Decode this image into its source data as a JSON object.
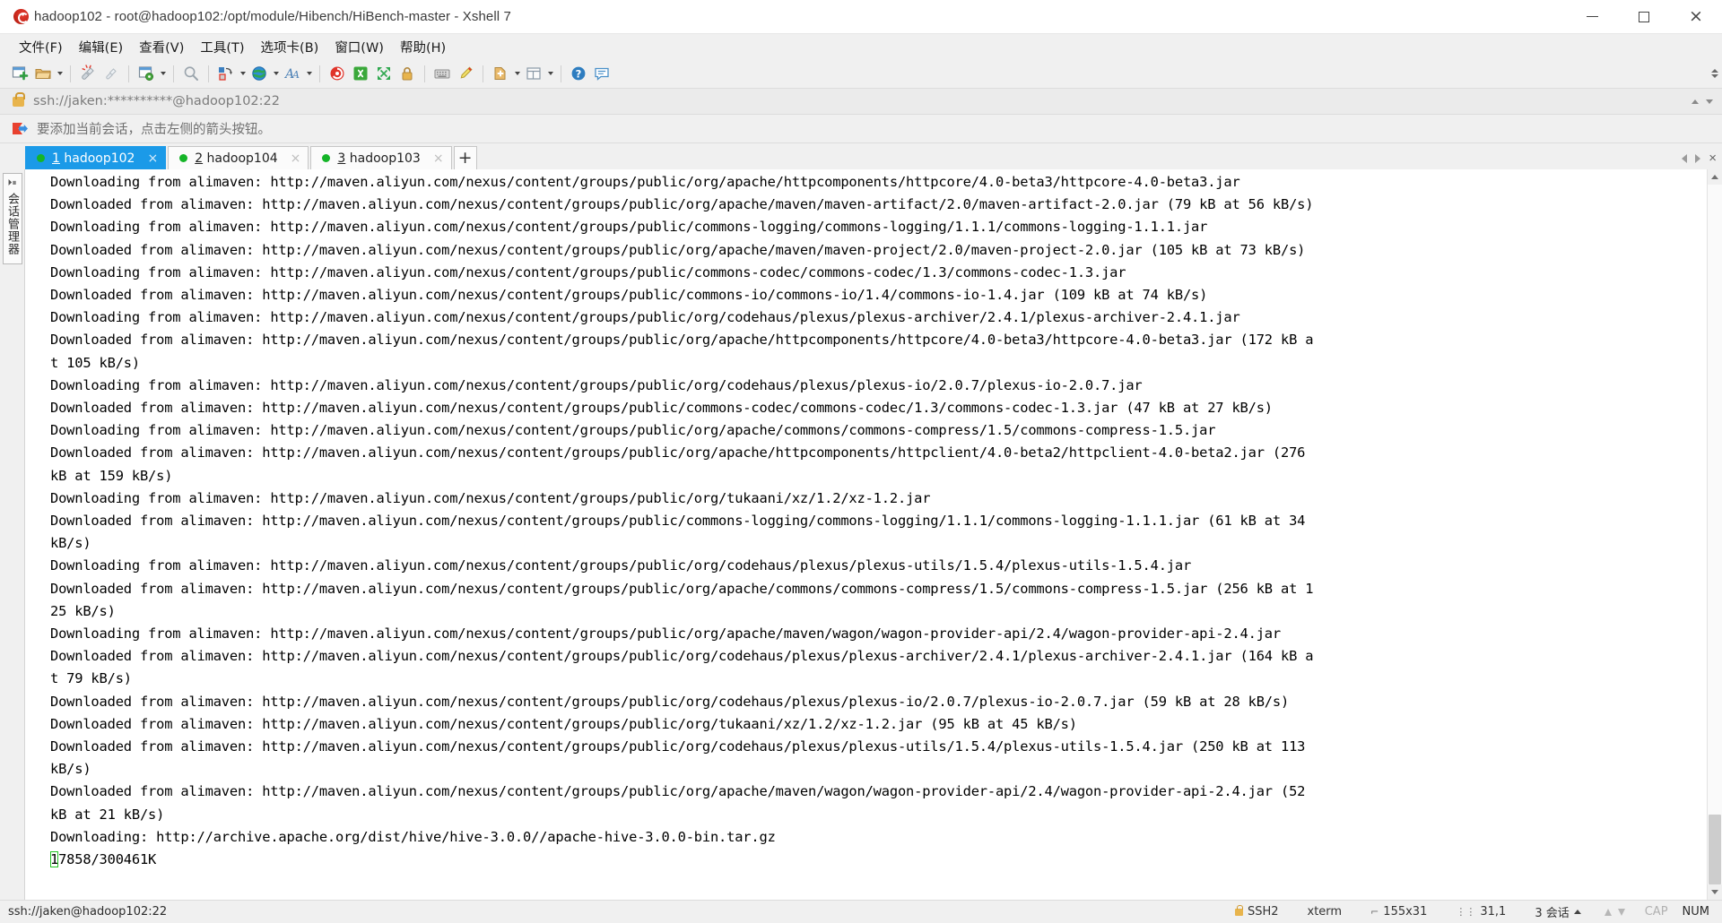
{
  "window": {
    "title": "hadoop102 - root@hadoop102:/opt/module/Hibench/HiBench-master - Xshell 7",
    "app_icon": "xshell-logo-icon",
    "minimize_label": "",
    "maximize_label": "",
    "close_label": "×"
  },
  "menu": {
    "items": [
      {
        "label": "文件(F)",
        "name": "menu-file"
      },
      {
        "label": "编辑(E)",
        "name": "menu-edit"
      },
      {
        "label": "查看(V)",
        "name": "menu-view"
      },
      {
        "label": "工具(T)",
        "name": "menu-tools"
      },
      {
        "label": "选项卡(B)",
        "name": "menu-tabs"
      },
      {
        "label": "窗口(W)",
        "name": "menu-window"
      },
      {
        "label": "帮助(H)",
        "name": "menu-help"
      }
    ]
  },
  "toolbar": {
    "icons": [
      "new-session-icon",
      "open-folder-icon",
      "open-dropdown-caret",
      "disconnect-icon",
      "reconnect-icon",
      "session-properties-icon",
      "properties-dropdown-caret",
      "find-icon",
      "transfer-file-icon",
      "transfer-dropdown-caret",
      "web-browser-icon",
      "browser-dropdown-caret",
      "font-icon",
      "font-dropdown-caret",
      "xshell-icon",
      "xftp-icon",
      "fullscreen-icon",
      "lock-icon",
      "keyboard-icon",
      "highlight-pen-icon",
      "add-note-icon",
      "note-dropdown-caret",
      "layout-icon",
      "layout-dropdown-caret",
      "help-icon",
      "feedback-icon"
    ]
  },
  "address_bar": {
    "lock_icon": "lock-icon",
    "value": "ssh://jaken:**********@hadoop102:22",
    "placeholder": "ssh://jaken:**********@hadoop102:22"
  },
  "hint_bar": {
    "icon": "bookmark-flag-icon",
    "text": "要添加当前会话，点击左侧的箭头按钮。"
  },
  "tabs": {
    "items": [
      {
        "num": "1",
        "label": " hadoop102",
        "active": true,
        "status": "connected",
        "close": "×"
      },
      {
        "num": "2",
        "label": " hadoop104",
        "active": false,
        "status": "connected",
        "close": "×"
      },
      {
        "num": "3",
        "label": " hadoop103",
        "active": false,
        "status": "connected",
        "close": "×"
      }
    ],
    "add_label": "+",
    "scroll_left": "",
    "scroll_right": "",
    "close_tab": "×"
  },
  "session_panel": {
    "title": "会话管理器",
    "pin_icon": "pin-icon"
  },
  "terminal": {
    "cursor_char": "1",
    "lines": [
      "Downloading from alimaven: http://maven.aliyun.com/nexus/content/groups/public/org/apache/httpcomponents/httpcore/4.0-beta3/httpcore-4.0-beta3.jar",
      "Downloaded from alimaven: http://maven.aliyun.com/nexus/content/groups/public/org/apache/maven/maven-artifact/2.0/maven-artifact-2.0.jar (79 kB at 56 kB/s)",
      "Downloading from alimaven: http://maven.aliyun.com/nexus/content/groups/public/commons-logging/commons-logging/1.1.1/commons-logging-1.1.1.jar",
      "Downloaded from alimaven: http://maven.aliyun.com/nexus/content/groups/public/org/apache/maven/maven-project/2.0/maven-project-2.0.jar (105 kB at 73 kB/s)",
      "Downloading from alimaven: http://maven.aliyun.com/nexus/content/groups/public/commons-codec/commons-codec/1.3/commons-codec-1.3.jar",
      "Downloaded from alimaven: http://maven.aliyun.com/nexus/content/groups/public/commons-io/commons-io/1.4/commons-io-1.4.jar (109 kB at 74 kB/s)",
      "Downloading from alimaven: http://maven.aliyun.com/nexus/content/groups/public/org/codehaus/plexus/plexus-archiver/2.4.1/plexus-archiver-2.4.1.jar",
      "Downloaded from alimaven: http://maven.aliyun.com/nexus/content/groups/public/org/apache/httpcomponents/httpcore/4.0-beta3/httpcore-4.0-beta3.jar (172 kB a",
      "t 105 kB/s)",
      "Downloading from alimaven: http://maven.aliyun.com/nexus/content/groups/public/org/codehaus/plexus/plexus-io/2.0.7/plexus-io-2.0.7.jar",
      "Downloaded from alimaven: http://maven.aliyun.com/nexus/content/groups/public/commons-codec/commons-codec/1.3/commons-codec-1.3.jar (47 kB at 27 kB/s)",
      "Downloading from alimaven: http://maven.aliyun.com/nexus/content/groups/public/org/apache/commons/commons-compress/1.5/commons-compress-1.5.jar",
      "Downloaded from alimaven: http://maven.aliyun.com/nexus/content/groups/public/org/apache/httpcomponents/httpclient/4.0-beta2/httpclient-4.0-beta2.jar (276",
      "kB at 159 kB/s)",
      "Downloading from alimaven: http://maven.aliyun.com/nexus/content/groups/public/org/tukaani/xz/1.2/xz-1.2.jar",
      "Downloaded from alimaven: http://maven.aliyun.com/nexus/content/groups/public/commons-logging/commons-logging/1.1.1/commons-logging-1.1.1.jar (61 kB at 34",
      "kB/s)",
      "Downloading from alimaven: http://maven.aliyun.com/nexus/content/groups/public/org/codehaus/plexus/plexus-utils/1.5.4/plexus-utils-1.5.4.jar",
      "Downloaded from alimaven: http://maven.aliyun.com/nexus/content/groups/public/org/apache/commons/commons-compress/1.5/commons-compress-1.5.jar (256 kB at 1",
      "25 kB/s)",
      "Downloading from alimaven: http://maven.aliyun.com/nexus/content/groups/public/org/apache/maven/wagon/wagon-provider-api/2.4/wagon-provider-api-2.4.jar",
      "Downloaded from alimaven: http://maven.aliyun.com/nexus/content/groups/public/org/codehaus/plexus/plexus-archiver/2.4.1/plexus-archiver-2.4.1.jar (164 kB a",
      "t 79 kB/s)",
      "Downloaded from alimaven: http://maven.aliyun.com/nexus/content/groups/public/org/codehaus/plexus/plexus-io/2.0.7/plexus-io-2.0.7.jar (59 kB at 28 kB/s)",
      "Downloaded from alimaven: http://maven.aliyun.com/nexus/content/groups/public/org/tukaani/xz/1.2/xz-1.2.jar (95 kB at 45 kB/s)",
      "Downloaded from alimaven: http://maven.aliyun.com/nexus/content/groups/public/org/codehaus/plexus/plexus-utils/1.5.4/plexus-utils-1.5.4.jar (250 kB at 113",
      "kB/s)",
      "Downloaded from alimaven: http://maven.aliyun.com/nexus/content/groups/public/org/apache/maven/wagon/wagon-provider-api/2.4/wagon-provider-api-2.4.jar (52",
      "kB at 21 kB/s)",
      "Downloading: http://archive.apache.org/dist/hive/hive-3.0.0//apache-hive-3.0.0-bin.tar.gz"
    ],
    "progress_line_prefix": "1",
    "progress_line_rest": "7858/300461K"
  },
  "status_bar": {
    "connection": "ssh://jaken@hadoop102:22",
    "protocol": "SSH2",
    "terminal_type": "xterm",
    "size": "155x31",
    "cursor_pos": "31,1",
    "sessions": "3 会话",
    "cap": "CAP",
    "num": "NUM",
    "lock_icon": "lock-icon",
    "size_icon": "terminal-size-icon",
    "cursor_icon": "cursor-position-icon",
    "sessions_caret": "caret-up-icon"
  },
  "colors": {
    "accent": "#1b9ae8",
    "tab_dot": "#15b528",
    "cursor": "#22c222",
    "chrome": "#f0f0f0",
    "terminal_bg": "#ffffff",
    "terminal_fg": "#000000",
    "hint_text": "#6f6f6f"
  }
}
